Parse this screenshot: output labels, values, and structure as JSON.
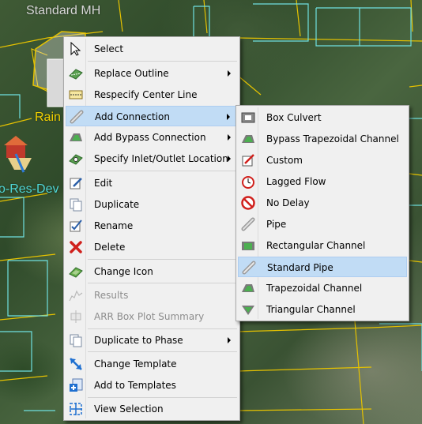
{
  "map": {
    "labels": {
      "standard_mh": "Standard MH",
      "rain": "Rain",
      "res_dev": "o-Res-Dev"
    }
  },
  "context_menu": {
    "items": [
      {
        "label": "Select",
        "icon": "cursor-arrow-icon",
        "submenu": false,
        "enabled": true
      },
      {
        "label": "Replace Outline",
        "icon": "outline-icon",
        "submenu": true,
        "enabled": true
      },
      {
        "label": "Respecify Center Line",
        "icon": "center-line-icon",
        "submenu": false,
        "enabled": true
      },
      {
        "label": "Add Connection",
        "icon": "pipe-icon",
        "submenu": true,
        "enabled": true,
        "highlighted": true
      },
      {
        "label": "Add Bypass Connection",
        "icon": "bypass-channel-icon",
        "submenu": true,
        "enabled": true
      },
      {
        "label": "Specify Inlet/Outlet Location",
        "icon": "inlet-outlet-icon",
        "submenu": true,
        "enabled": true
      },
      {
        "label": "Edit",
        "icon": "edit-icon",
        "submenu": false,
        "enabled": true
      },
      {
        "label": "Duplicate",
        "icon": "duplicate-icon",
        "submenu": false,
        "enabled": true
      },
      {
        "label": "Rename",
        "icon": "rename-icon",
        "submenu": false,
        "enabled": true
      },
      {
        "label": "Delete",
        "icon": "delete-x-icon",
        "submenu": false,
        "enabled": true
      },
      {
        "label": "Change Icon",
        "icon": "change-icon-icon",
        "submenu": false,
        "enabled": true
      },
      {
        "label": "Results",
        "icon": "results-chart-icon",
        "submenu": false,
        "enabled": false
      },
      {
        "label": "ARR Box Plot Summary",
        "icon": "box-plot-icon",
        "submenu": false,
        "enabled": false
      },
      {
        "label": "Duplicate to Phase",
        "icon": "duplicate-phase-icon",
        "submenu": true,
        "enabled": true
      },
      {
        "label": "Change Template",
        "icon": "change-template-icon",
        "submenu": false,
        "enabled": true
      },
      {
        "label": "Add to Templates",
        "icon": "add-template-icon",
        "submenu": false,
        "enabled": true
      },
      {
        "label": "View Selection",
        "icon": "view-selection-icon",
        "submenu": false,
        "enabled": true
      }
    ]
  },
  "connection_submenu": {
    "items": [
      {
        "label": "Box Culvert",
        "icon": "box-culvert-icon"
      },
      {
        "label": "Bypass Trapezoidal Channel",
        "icon": "bypass-trapezoidal-channel-icon"
      },
      {
        "label": "Custom",
        "icon": "custom-icon"
      },
      {
        "label": "Lagged Flow",
        "icon": "lagged-flow-clock-icon"
      },
      {
        "label": "No Delay",
        "icon": "no-delay-icon"
      },
      {
        "label": "Pipe",
        "icon": "pipe-icon"
      },
      {
        "label": "Rectangular Channel",
        "icon": "rectangular-channel-icon"
      },
      {
        "label": "Standard Pipe",
        "icon": "standard-pipe-icon",
        "highlighted": true
      },
      {
        "label": "Trapezoidal Channel",
        "icon": "trapezoidal-channel-icon"
      },
      {
        "label": "Triangular Channel",
        "icon": "triangular-channel-icon"
      }
    ]
  },
  "colors": {
    "highlight": "#c1dcf5",
    "menu_bg": "#f0f0f0",
    "line_yellow": "#e6c200",
    "line_cyan": "#6fe0e0",
    "rain_label": "#f2d000",
    "res_label": "#4fd6d6"
  }
}
